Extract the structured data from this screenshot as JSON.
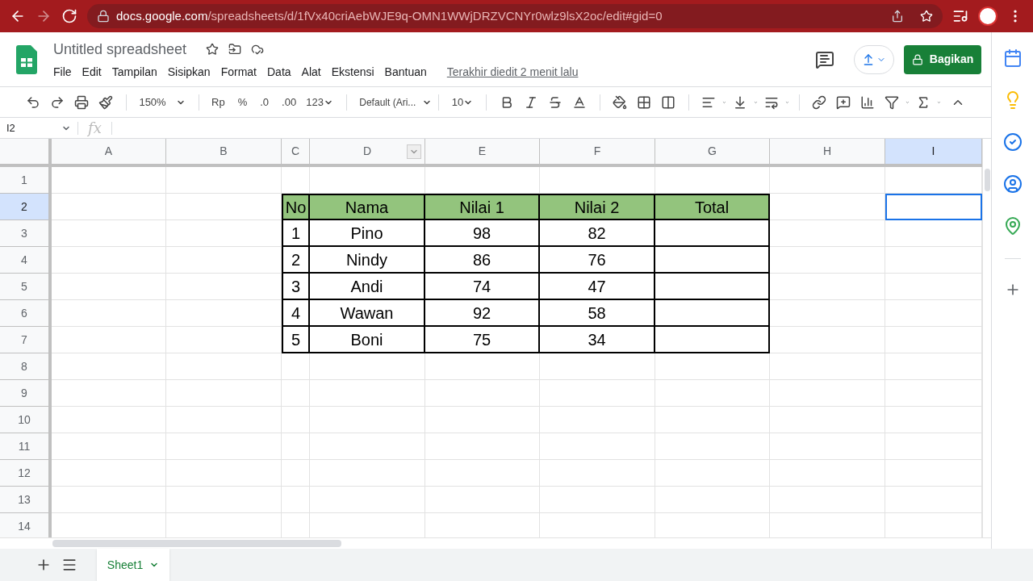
{
  "browser": {
    "url_host": "docs.google.com",
    "url_path": "/spreadsheets/d/1fVx40criAebWJE9q-OMN1WWjDRZVCNYr0wlz9lsX2oc/edit#gid=0"
  },
  "doc": {
    "title": "Untitled spreadsheet",
    "menu": [
      "File",
      "Edit",
      "Tampilan",
      "Sisipkan",
      "Format",
      "Data",
      "Alat",
      "Ekstensi",
      "Bantuan"
    ],
    "last_edit": "Terakhir diedit 2 menit lalu",
    "share_label": "Bagikan"
  },
  "toolbar": {
    "zoom": "150%",
    "currency": "Rp",
    "percent": "%",
    "decrease_decimal": ".0",
    "increase_decimal": ".00",
    "number_format": "123",
    "font": "Default (Ari...",
    "font_size": "10"
  },
  "formula_bar": {
    "cell_ref": "I2",
    "fx": "fx"
  },
  "grid": {
    "columns": [
      {
        "label": "A",
        "selected": false
      },
      {
        "label": "B",
        "selected": false
      },
      {
        "label": "C",
        "selected": false
      },
      {
        "label": "D",
        "selected": false
      },
      {
        "label": "E",
        "selected": false
      },
      {
        "label": "F",
        "selected": false
      },
      {
        "label": "G",
        "selected": false
      },
      {
        "label": "H",
        "selected": false
      },
      {
        "label": "I",
        "selected": true
      }
    ],
    "rows": [
      {
        "label": "1",
        "selected": false
      },
      {
        "label": "2",
        "selected": true
      },
      {
        "label": "3",
        "selected": false
      },
      {
        "label": "4",
        "selected": false
      },
      {
        "label": "5",
        "selected": false
      },
      {
        "label": "6",
        "selected": false
      },
      {
        "label": "7",
        "selected": false
      },
      {
        "label": "8",
        "selected": false
      },
      {
        "label": "9",
        "selected": false
      },
      {
        "label": "10",
        "selected": false
      },
      {
        "label": "11",
        "selected": false
      },
      {
        "label": "12",
        "selected": false
      },
      {
        "label": "13",
        "selected": false
      },
      {
        "label": "14",
        "selected": false
      }
    ]
  },
  "table": {
    "header": [
      "No",
      "Nama",
      "Nilai 1",
      "Nilai 2",
      "Total"
    ],
    "rows": [
      [
        "1",
        "Pino",
        "98",
        "82"
      ],
      [
        "2",
        "Nindy",
        "86",
        "76"
      ],
      [
        "3",
        "Andi",
        "74",
        "47"
      ],
      [
        "4",
        "Wawan",
        "92",
        "58"
      ],
      [
        "5",
        "Boni",
        "75",
        "34"
      ]
    ]
  },
  "sheets": [
    {
      "label": "Sheet1",
      "selected": true
    }
  ]
}
